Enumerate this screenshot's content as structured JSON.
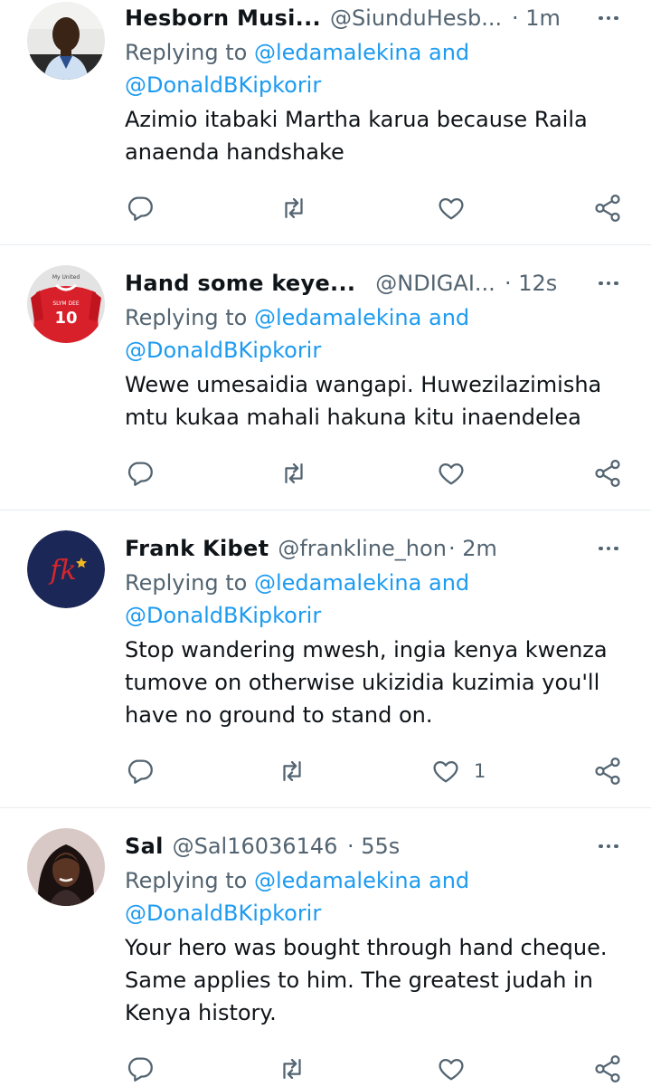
{
  "colors": {
    "accent": "#1d9bf0",
    "secondary_text": "#536471",
    "divider": "#e6ecf0"
  },
  "tweets": [
    {
      "name": "Hesborn Musi...",
      "handle": "@SiunduHesb...",
      "time": "· 1m",
      "replying_prefix": "Replying to",
      "mention1": "@ledamalekina",
      "and": "and",
      "mention2": "@DonaldBKipkorir",
      "text": "Azimio itabaki Martha karua because Raila anaenda handshake",
      "like_count": "",
      "avatar": "man-in-office-photo"
    },
    {
      "name": "Hand some keye...",
      "handle": "@NDIGAI...",
      "time": "· 12s",
      "replying_prefix": "Replying to",
      "mention1": "@ledamalekina",
      "and": "and",
      "mention2": "@DonaldBKipkorir",
      "text": "Wewe umesaidia wangapi. Huwezilazimisha mtu kukaa mahali hakuna kitu inaendelea",
      "like_count": "",
      "avatar": "red-jersey-photo",
      "avatar_text": {
        "top": "My United",
        "name": "SLYM DEE",
        "number": "10"
      }
    },
    {
      "name": "Frank Kibet",
      "handle": "@frankline_hon",
      "time": "· 2m",
      "replying_prefix": "Replying to",
      "mention1": "@ledamalekina",
      "and": "and",
      "mention2": "@DonaldBKipkorir",
      "text": "Stop wandering mwesh, ingia kenya kwenza tumove on otherwise ukizidia kuzimia you'll have no ground to stand on.",
      "like_count": "1",
      "avatar": "fk-logo",
      "avatar_text": {
        "logo": "fk"
      }
    },
    {
      "name": "Sal",
      "handle": "@Sal16036146",
      "time": "· 55s",
      "replying_prefix": "Replying to",
      "mention1": "@ledamalekina",
      "and": "and",
      "mention2": "@DonaldBKipkorir",
      "text": "Your hero was bought through hand cheque. Same applies to him. The greatest judah in Kenya history.",
      "like_count": "",
      "avatar": "woman-portrait-photo"
    }
  ]
}
